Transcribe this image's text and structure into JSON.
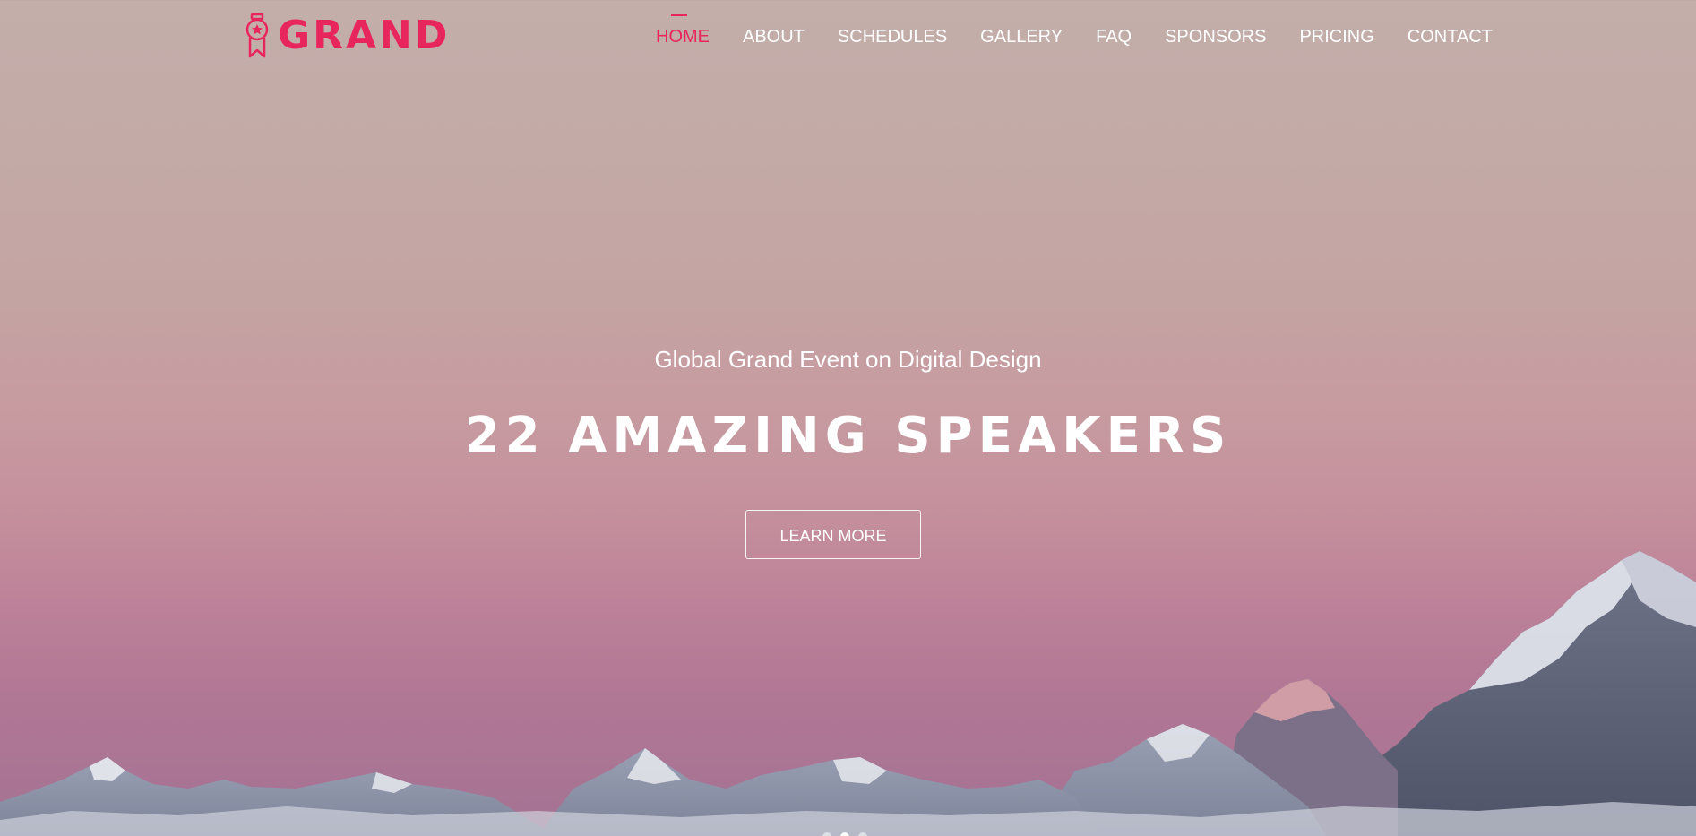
{
  "brand": {
    "name": "GRAND",
    "color": "#e8265e"
  },
  "nav": {
    "items": [
      {
        "label": "HOME",
        "active": true
      },
      {
        "label": "ABOUT"
      },
      {
        "label": "SCHEDULES"
      },
      {
        "label": "GALLERY"
      },
      {
        "label": "FAQ"
      },
      {
        "label": "SPONSORS"
      },
      {
        "label": "PRICING"
      },
      {
        "label": "CONTACT"
      }
    ]
  },
  "hero": {
    "subtitle": "Global Grand Event on Digital Design",
    "headline": "22 AMAZING SPEAKERS",
    "cta_label": "LEARN MORE",
    "background": "mountain-sunset-image",
    "slides": {
      "count": 3,
      "active_index": 1
    }
  },
  "colors": {
    "accent": "#e8265e",
    "text": "#ffffff"
  }
}
